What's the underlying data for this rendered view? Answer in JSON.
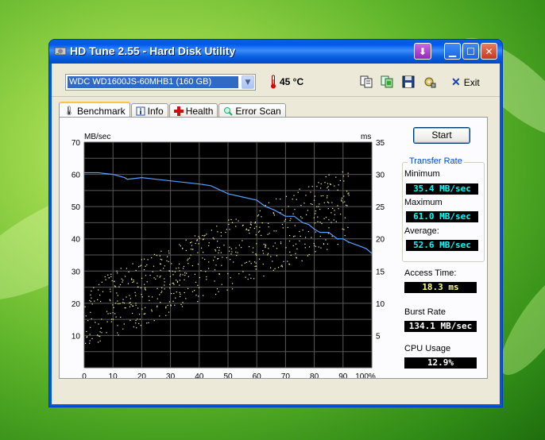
{
  "window": {
    "title": "HD Tune 2.55 - Hard Disk Utility",
    "title_color": "#ffffff",
    "titlebar_color": "#0058ee"
  },
  "toolbar": {
    "drive": "WDC WD1600JS-60MHB1 (160 GB)",
    "temperature": "45 °C",
    "exit_label": "Exit",
    "icons": [
      "copy-icon",
      "copy-screenshot-icon",
      "save-icon",
      "options-icon",
      "exit-icon"
    ]
  },
  "tabs": [
    {
      "label": "Benchmark",
      "icon": "benchmark-icon",
      "active": true
    },
    {
      "label": "Info",
      "icon": "info-icon",
      "active": false
    },
    {
      "label": "Health",
      "icon": "health-icon",
      "active": false
    },
    {
      "label": "Error Scan",
      "icon": "error-scan-icon",
      "active": false
    }
  ],
  "start_button": "Start",
  "transfer_rate": {
    "title": "Transfer Rate",
    "minimum_label": "Minimum",
    "minimum": "35.4 MB/sec",
    "maximum_label": "Maximum",
    "maximum": "61.0 MB/sec",
    "average_label": "Average:",
    "average": "52.6 MB/sec"
  },
  "access_time": {
    "label": "Access Time:",
    "value": "18.3 ms"
  },
  "burst_rate": {
    "label": "Burst Rate",
    "value": "134.1 MB/sec"
  },
  "cpu_usage": {
    "label": "CPU Usage",
    "value": "12.9%"
  },
  "chart_data": {
    "type": "line",
    "left_axis_label": "MB/sec",
    "right_axis_label": "ms",
    "left_ticks": [
      "70",
      "60",
      "50",
      "40",
      "30",
      "20",
      "10"
    ],
    "right_ticks": [
      "35",
      "30",
      "25",
      "20",
      "15",
      "10",
      "5"
    ],
    "x_ticks": [
      "0",
      "10",
      "20",
      "30",
      "40",
      "50",
      "60",
      "70",
      "80",
      "90",
      "100%"
    ],
    "ylim": [
      0,
      70
    ],
    "y2lim": [
      0,
      35
    ],
    "xlim": [
      0,
      100
    ],
    "line_color": "#5aa0ff",
    "point_color": "#ffffa0",
    "grid": true,
    "transfer_series": {
      "name": "Transfer Rate",
      "x": [
        0,
        5,
        10,
        14,
        15,
        20,
        25,
        30,
        35,
        40,
        44,
        50,
        55,
        60,
        63,
        66,
        68,
        70,
        73,
        76,
        78,
        80,
        82,
        85,
        88,
        90,
        92,
        95,
        98,
        100
      ],
      "y": [
        60.5,
        60.5,
        60,
        59,
        58.5,
        59,
        58.5,
        58,
        57.5,
        57,
        56.5,
        54,
        53,
        52,
        50,
        49,
        48,
        47,
        47,
        45,
        44.5,
        43,
        42,
        42,
        40,
        40,
        39,
        38,
        37,
        35.5
      ]
    },
    "access_points_summary": "scattered access-time samples trending from ~5-15 ms at 0% up to ~25-30 ms near 90%"
  }
}
